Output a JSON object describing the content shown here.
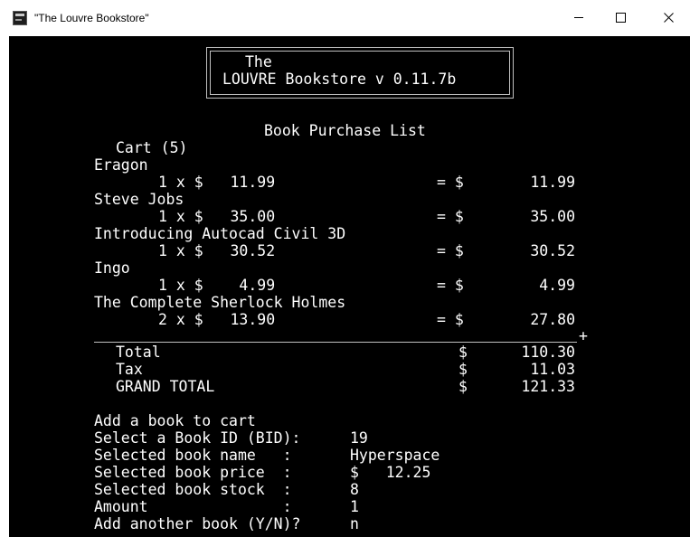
{
  "window": {
    "title": "\"The Louvre Bookstore\"",
    "app_icon": "console-app-icon",
    "controls": {
      "minimize_icon": "minimize-icon",
      "maximize_icon": "maximize-icon",
      "close_icon": "close-icon"
    }
  },
  "colors": {
    "console_background": "#000000",
    "console_text": "#ffffff",
    "titlebar_background": "#ffffff"
  },
  "header": {
    "line1": "The",
    "line2": "LOUVRE Bookstore v 0.11.7b"
  },
  "purchase_list": {
    "heading": "Book Purchase List",
    "cart_label": "Cart (5)",
    "items": [
      {
        "title": "Eragon",
        "qty_price": "1 x $   11.99",
        "eq": "= $",
        "line_total": "11.99"
      },
      {
        "title": "Steve Jobs",
        "qty_price": "1 x $   35.00",
        "eq": "= $",
        "line_total": "35.00"
      },
      {
        "title": "Introducing Autocad Civil 3D",
        "qty_price": "1 x $   30.52",
        "eq": "= $",
        "line_total": "30.52"
      },
      {
        "title": "Ingo",
        "qty_price": "1 x $    4.99",
        "eq": "= $",
        "line_total": "4.99"
      },
      {
        "title": "The Complete Sherlock Holmes",
        "qty_price": "2 x $   13.90",
        "eq": "= $",
        "line_total": "27.80"
      }
    ],
    "separator_end": "+"
  },
  "totals": [
    {
      "label": "Total",
      "currency": "$",
      "value": "110.30"
    },
    {
      "label": "Tax",
      "currency": "$",
      "value": "11.03"
    },
    {
      "label": "GRAND TOTAL",
      "currency": "$",
      "value": "121.33"
    }
  ],
  "prompt": {
    "title": "Add a book to cart",
    "bid_label": "Select a Book ID (BID):",
    "bid_value": "19",
    "name_label": "Selected book name   :",
    "name_value": "Hyperspace",
    "price_label": "Selected book price  :",
    "price_value": "$   12.25",
    "stock_label": "Selected book stock  :",
    "stock_value": "8",
    "amount_label": "Amount               :",
    "amount_value": "1",
    "another_label": "Add another book (Y/N)?",
    "another_value": "n"
  }
}
